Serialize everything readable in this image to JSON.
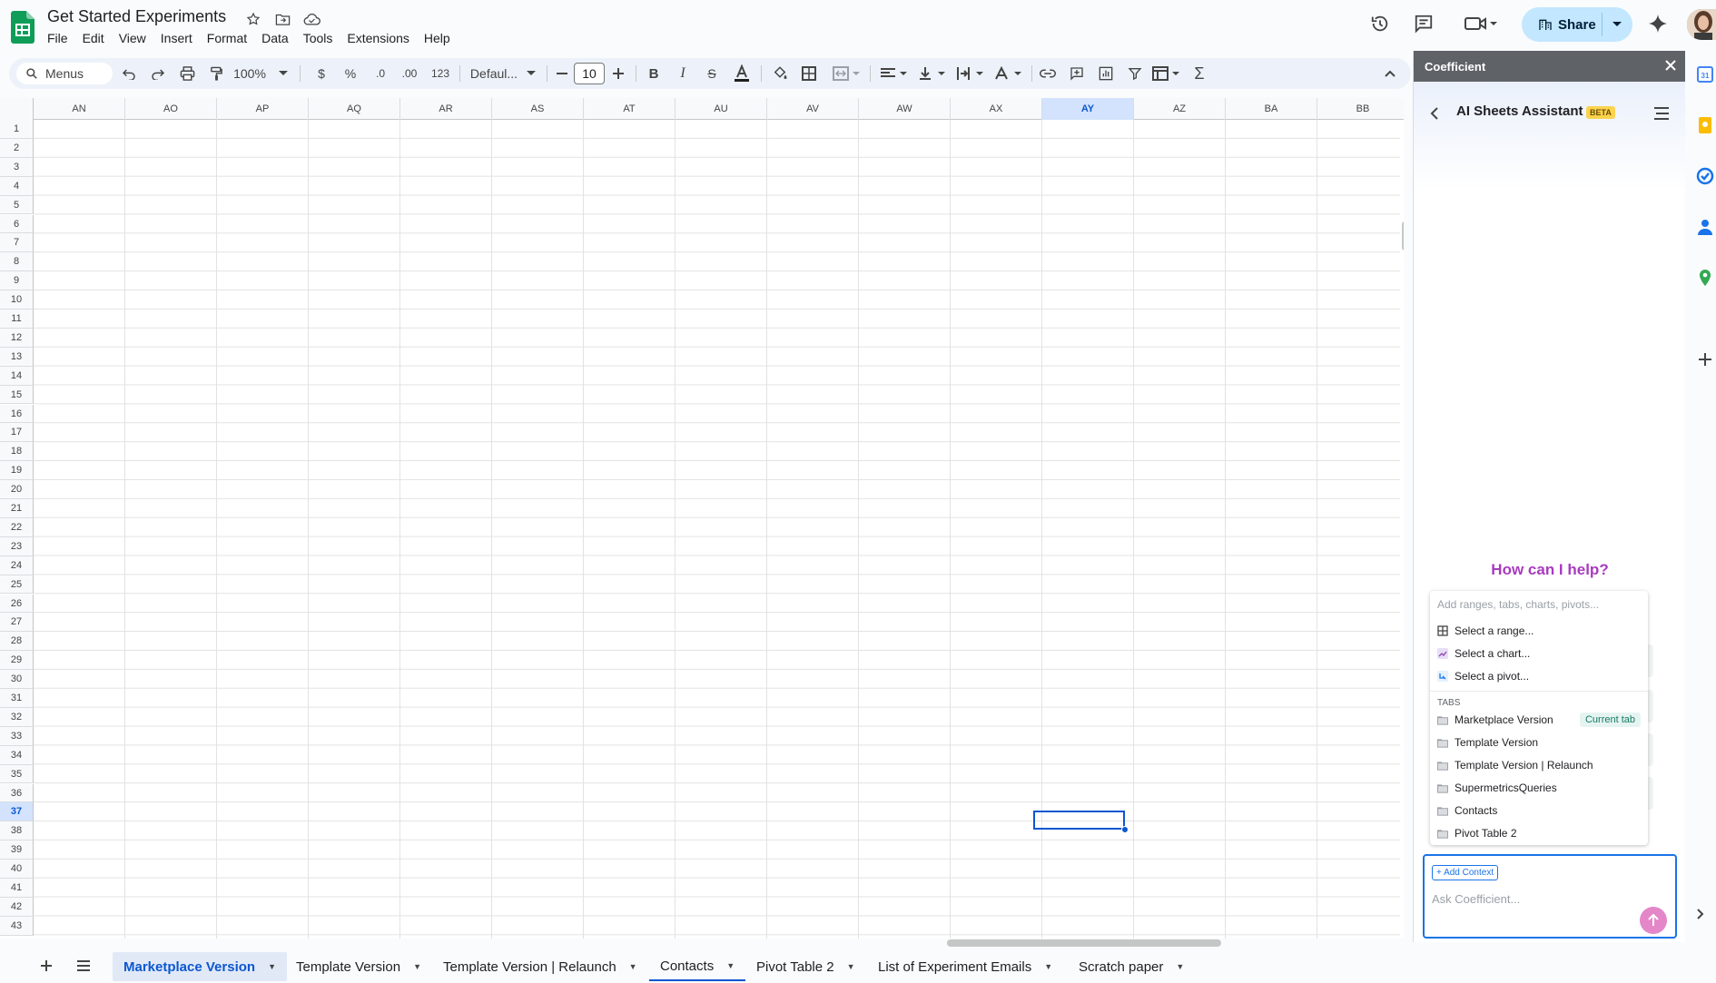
{
  "header": {
    "doc_title": "Get Started Experiments",
    "menu": [
      "File",
      "Edit",
      "View",
      "Insert",
      "Format",
      "Data",
      "Tools",
      "Extensions",
      "Help"
    ],
    "share_label": "Share"
  },
  "toolbar": {
    "menus_label": "Menus",
    "zoom": "100%",
    "currency": "$",
    "percent": "%",
    "dec_decrease": ".0",
    "dec_increase": ".00",
    "number_format": "123",
    "font": "Defaul...",
    "font_size": "10"
  },
  "grid": {
    "columns": [
      "AN",
      "AO",
      "AP",
      "AQ",
      "AR",
      "AS",
      "AT",
      "AU",
      "AV",
      "AW",
      "AX",
      "AY",
      "AZ",
      "BA",
      "BB"
    ],
    "selected_column": "AY",
    "rows": [
      "1",
      "2",
      "3",
      "4",
      "5",
      "6",
      "7",
      "8",
      "9",
      "10",
      "11",
      "12",
      "13",
      "14",
      "15",
      "16",
      "17",
      "18",
      "19",
      "20",
      "21",
      "22",
      "23",
      "24",
      "25",
      "26",
      "27",
      "28",
      "29",
      "30",
      "31",
      "32",
      "33",
      "34",
      "35",
      "36",
      "37",
      "38",
      "39",
      "40",
      "41",
      "42",
      "43"
    ],
    "selected_row": "37"
  },
  "sheet_tabs": [
    {
      "label": "Marketplace Version",
      "active": true
    },
    {
      "label": "Template Version",
      "active": false
    },
    {
      "label": "Template Version | Relaunch",
      "active": false
    },
    {
      "label": "Contacts",
      "active": false
    },
    {
      "label": "Pivot Table 2",
      "active": false
    },
    {
      "label": "List of Experiment Emails",
      "active": false
    },
    {
      "label": "Scratch paper",
      "active": false
    }
  ],
  "panel": {
    "title": "Coefficient",
    "assistant_title": "AI Sheets Assistant",
    "beta_badge": "BETA",
    "help_heading": "How can I help?",
    "context_placeholder": "Add ranges, tabs, charts, pivots...",
    "select_items": [
      "Select a range...",
      "Select a chart...",
      "Select a pivot..."
    ],
    "tabs_label": "TABS",
    "tabs": [
      "Marketplace Version",
      "Template Version",
      "Template Version | Relaunch",
      "SupermetricsQueries",
      "Contacts",
      "Pivot Table 2"
    ],
    "current_tab_badge": "Current tab",
    "add_context_label": "+ Add Context",
    "ask_placeholder": "Ask Coefficient..."
  },
  "colors": {
    "accent": "#0b57d0",
    "share_bg": "#c2e7ff",
    "help_heading": "#a83bbf",
    "send_button": "#e487c9"
  }
}
